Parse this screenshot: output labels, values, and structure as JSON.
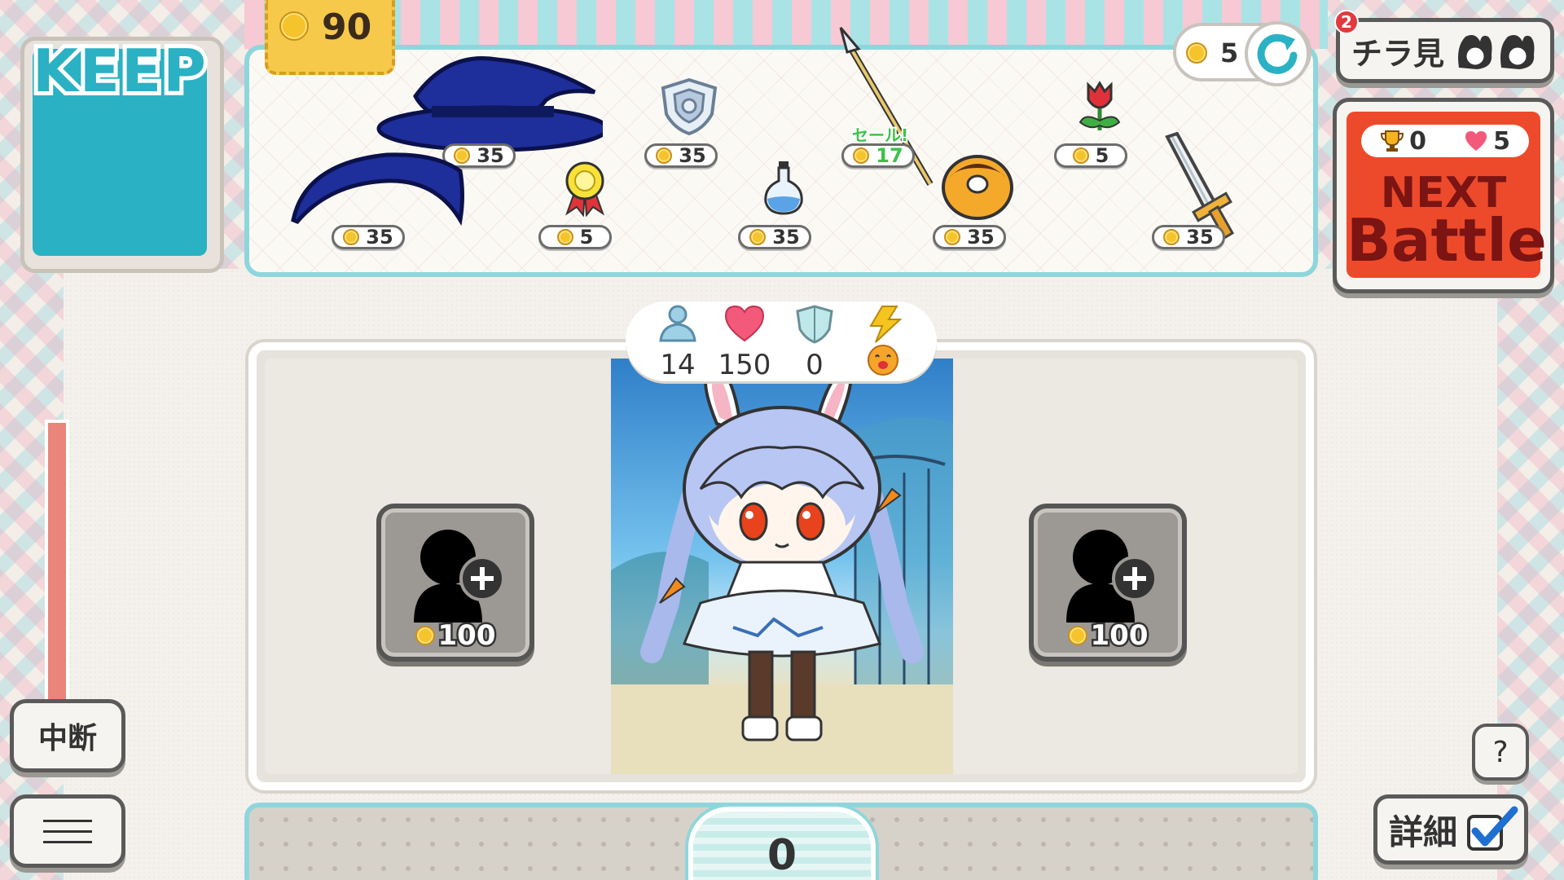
{
  "keep": {
    "title": "KEEP"
  },
  "wallet": {
    "coins": "90"
  },
  "shop": {
    "items": [
      {
        "name": "blue-hat",
        "price": "35"
      },
      {
        "name": "blue-wig",
        "price": "35"
      },
      {
        "name": "rosette-badge",
        "price": "5"
      },
      {
        "name": "shield-charm",
        "price": "35"
      },
      {
        "name": "potion-flask",
        "price": "35"
      },
      {
        "name": "spear",
        "price": "17",
        "sale_label": "セール!"
      },
      {
        "name": "donut",
        "price": "35"
      },
      {
        "name": "red-flower",
        "price": "5"
      },
      {
        "name": "sword",
        "price": "35"
      }
    ]
  },
  "refresh": {
    "cost": "5"
  },
  "peek": {
    "label": "チラ見",
    "badge": "2"
  },
  "next_battle": {
    "trophies": "0",
    "hearts": "5",
    "line1": "NEXT",
    "line2": "Battle"
  },
  "character_stats": {
    "units": "14",
    "hp": "150",
    "defense": "0"
  },
  "slots": {
    "left_cost": "100",
    "right_cost": "100"
  },
  "buttons": {
    "suspend": "中断",
    "help": "?",
    "detail": "詳細"
  },
  "bottom": {
    "value": "0"
  },
  "colors": {
    "accent": "#8fd6dc",
    "battle": "#ed4a2c",
    "keep": "#2ab1c3"
  }
}
